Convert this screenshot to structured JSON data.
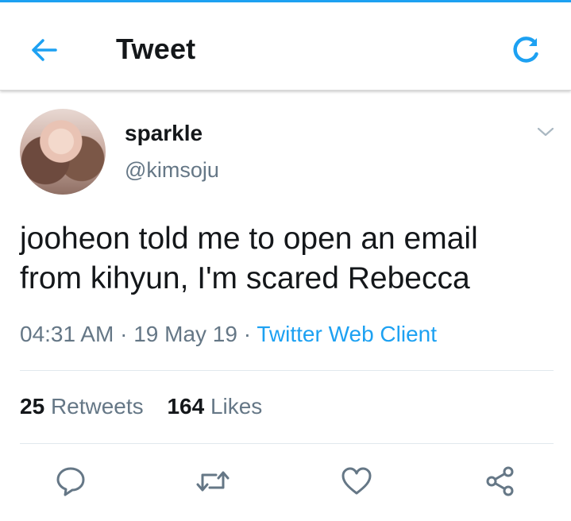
{
  "header": {
    "title": "Tweet",
    "back_icon": "arrow-left-icon",
    "refresh_icon": "refresh-icon",
    "accent_color": "#1da1f2"
  },
  "tweet": {
    "display_name": "sparkle",
    "handle": "@kimsoju",
    "text_line1": "jooheon told me to open an email",
    "text_line2": "from kihyun, I'm scared Rebecca",
    "time": "04:31 AM",
    "date": "19 May 19",
    "client": "Twitter Web Client",
    "separator": "·"
  },
  "stats": {
    "retweets_count": "25",
    "retweets_label": "Retweets",
    "likes_count": "164",
    "likes_label": "Likes"
  },
  "actions": [
    "reply-icon",
    "retweet-icon",
    "like-icon",
    "share-icon"
  ]
}
